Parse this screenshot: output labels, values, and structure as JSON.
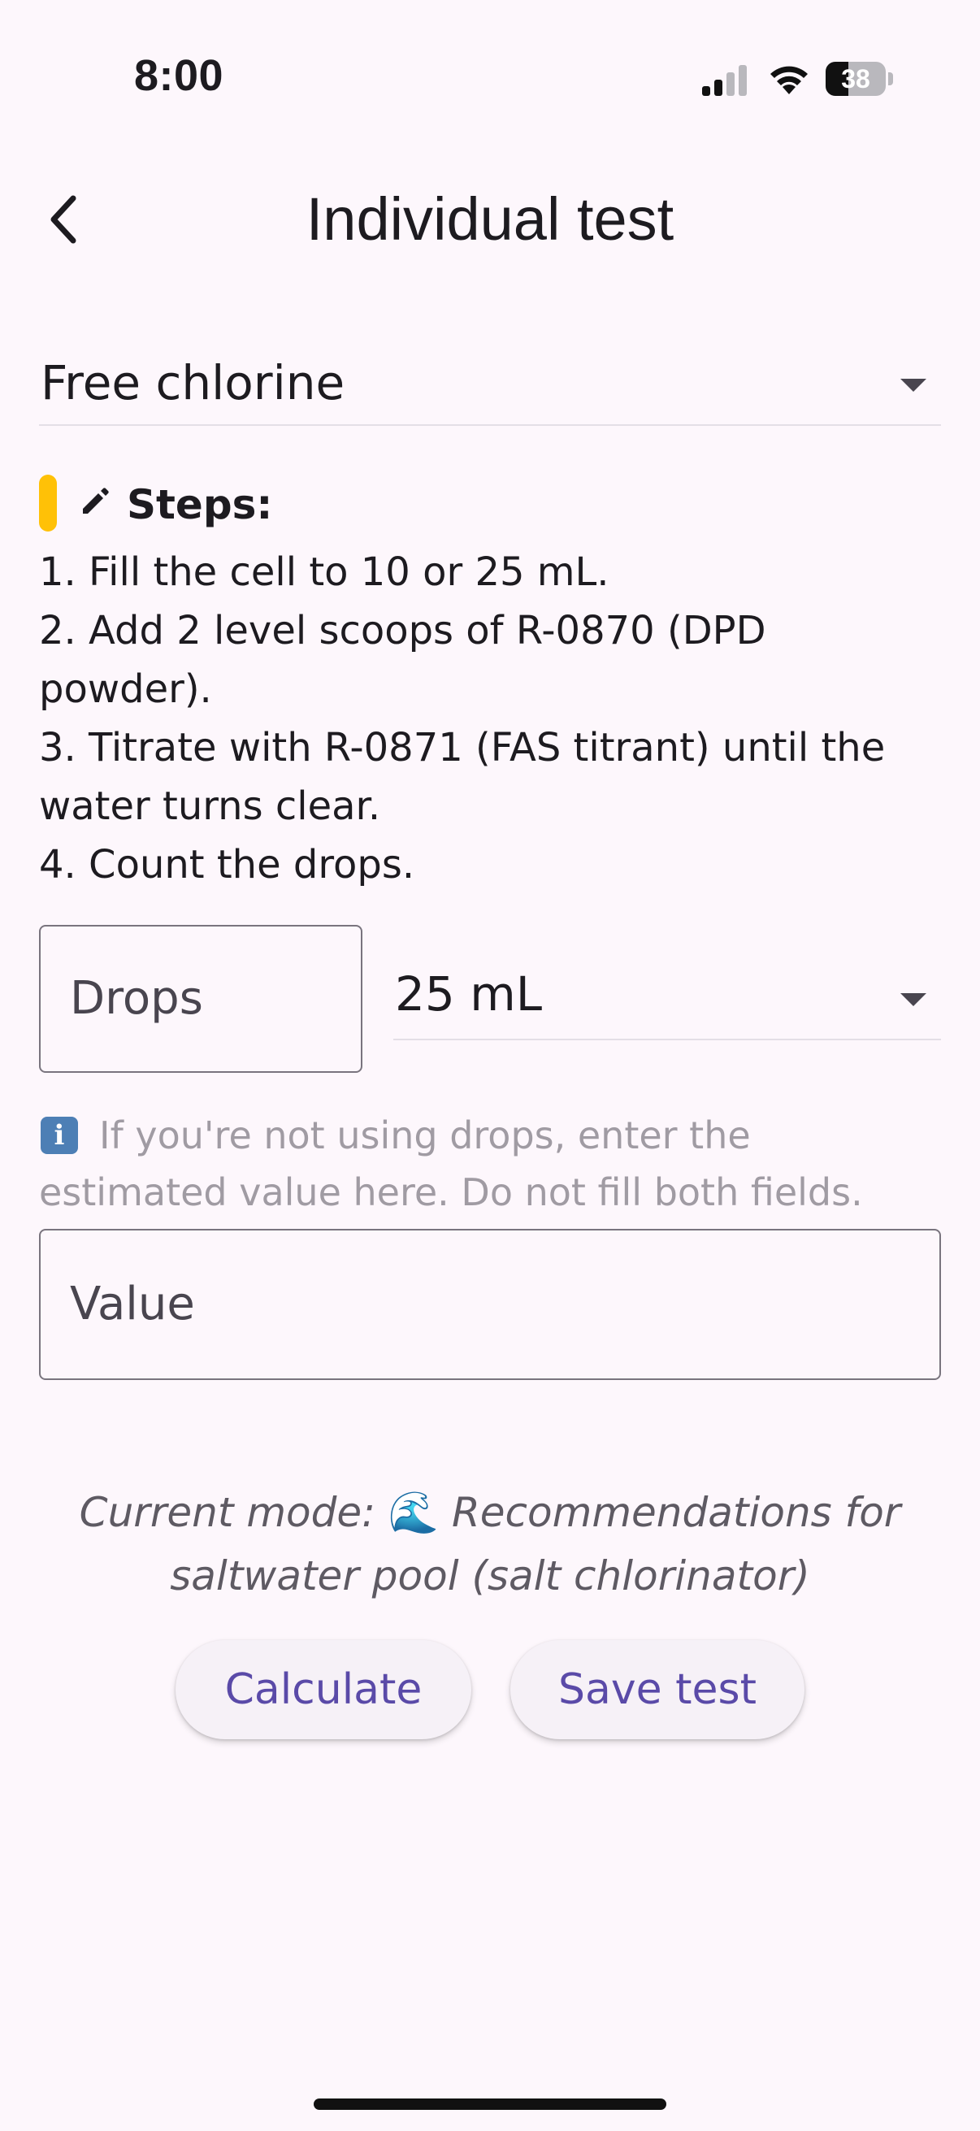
{
  "status_bar": {
    "time": "8:00",
    "battery_level": "38",
    "battery_fraction": 0.38,
    "icons": [
      "signal-icon",
      "wifi-icon",
      "battery-icon"
    ]
  },
  "app_bar": {
    "title": "Individual test",
    "back_icon": "chevron-left-icon"
  },
  "test_select": {
    "value": "Free chlorine"
  },
  "steps": {
    "label": "Steps:",
    "accent_color": "#ffc107",
    "icon": "pencil-icon",
    "items": [
      "1. Fill the cell to 10 or 25 mL.",
      "2. Add 2 level scoops of R-0870 (DPD powder).",
      "3. Titrate with R-0871 (FAS titrant) until the water turns clear.",
      "4. Count the drops."
    ]
  },
  "drops_field": {
    "placeholder": "Drops"
  },
  "volume_select": {
    "value": "25 mL"
  },
  "hint": {
    "icon": "info-icon",
    "icon_glyph": "i",
    "text": "If you're not using drops, enter the estimated value here. Do not fill both fields."
  },
  "value_field": {
    "placeholder": "Value"
  },
  "mode": {
    "prefix": "Current mode:",
    "emoji": "🌊",
    "text": "Recommendations for saltwater pool (salt chlorinator)"
  },
  "buttons": {
    "calculate": "Calculate",
    "save": "Save test"
  },
  "colors": {
    "background": "#fdf7fc",
    "button_text": "#5a4aa8",
    "hint_text": "#a09ba3"
  }
}
